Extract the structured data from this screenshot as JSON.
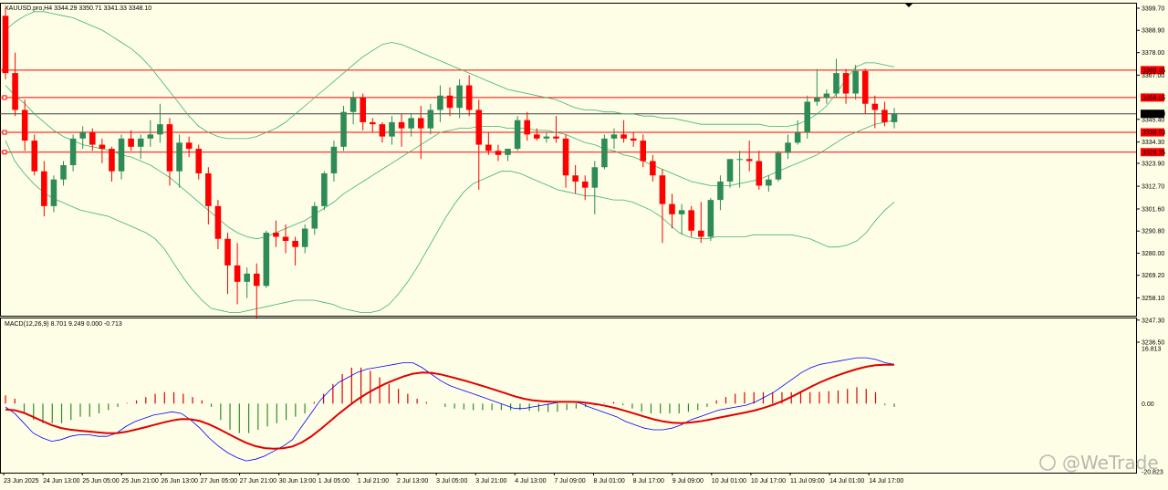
{
  "header": {
    "symbol_line": "XAUUSD.pro,H4  3344.29 3350.71 3341.33 3348.10",
    "macd_line": "MACD(12,26,9) 8.701 9.249 0.000 -0.713"
  },
  "watermark": "@WeTrade",
  "colors": {
    "background": "#fefee6",
    "bull": "#2e8b57",
    "bear": "#ff0000",
    "band": "#3cb371",
    "hline": "#ff0000",
    "macd_line": "#0000ff",
    "signal_line": "#e00000"
  },
  "chart_data": [
    {
      "type": "candlestick",
      "symbol": "XAUUSD.pro",
      "timeframe": "H4",
      "ylim": [
        3236.5,
        3399.7
      ],
      "y_ticks": [
        3399.7,
        3388.9,
        3378.0,
        3367.0,
        3345.4,
        3334.3,
        3323.9,
        3312.7,
        3301.6,
        3290.8,
        3280.0,
        3269.2,
        3258.1,
        3247.3,
        3236.5
      ],
      "price_levels": [
        {
          "label": "3369.45",
          "value": 3369.45
        },
        {
          "label": "3356.05",
          "value": 3356.05
        },
        {
          "label": "3339.03",
          "value": 3339.03
        },
        {
          "label": "3329.35",
          "value": 3329.35
        }
      ],
      "current_price": {
        "label": "3348.10",
        "value": 3348.1
      },
      "x_labels": [
        "23 Jun 2025",
        "24 Jun 13:00",
        "25 Jun 05:00",
        "25 Jun 21:00",
        "26 Jun 13:00",
        "27 Jun 05:00",
        "27 Jun 21:00",
        "30 Jun 13:00",
        "1 Jul 05:00",
        "1 Jul 21:00",
        "2 Jul 13:00",
        "3 Jul 05:00",
        "3 Jul 21:00",
        "4 Jul 13:00",
        "7 Jul 09:00",
        "8 Jul 01:00",
        "8 Jul 17:00",
        "9 Jul 09:00",
        "10 Jul 01:00",
        "10 Jul 17:00",
        "11 Jul 09:00",
        "14 Jul 01:00",
        "14 Jul 17:00"
      ],
      "candles": [
        [
          3396,
          3400,
          3365,
          3368
        ],
        [
          3368,
          3378,
          3347,
          3350
        ],
        [
          3350,
          3355,
          3330,
          3335
        ],
        [
          3335,
          3338,
          3318,
          3320
        ],
        [
          3320,
          3325,
          3298,
          3303
        ],
        [
          3303,
          3318,
          3300,
          3316
        ],
        [
          3316,
          3325,
          3313,
          3323
        ],
        [
          3323,
          3338,
          3320,
          3336
        ],
        [
          3336,
          3342,
          3331,
          3339
        ],
        [
          3339,
          3341,
          3330,
          3333
        ],
        [
          3333,
          3336,
          3324,
          3331
        ],
        [
          3331,
          3332,
          3315,
          3320
        ],
        [
          3320,
          3338,
          3316,
          3336
        ],
        [
          3336,
          3340,
          3330,
          3332
        ],
        [
          3332,
          3338,
          3326,
          3336
        ],
        [
          3336,
          3345,
          3332,
          3338
        ],
        [
          3338,
          3353,
          3334,
          3343
        ],
        [
          3343,
          3346,
          3313,
          3320
        ],
        [
          3320,
          3338,
          3312,
          3334
        ],
        [
          3334,
          3337,
          3327,
          3331
        ],
        [
          3331,
          3333,
          3316,
          3319
        ],
        [
          3319,
          3322,
          3294,
          3303
        ],
        [
          3303,
          3306,
          3282,
          3287
        ],
        [
          3287,
          3290,
          3260,
          3274
        ],
        [
          3274,
          3285,
          3255,
          3266
        ],
        [
          3266,
          3273,
          3258,
          3270
        ],
        [
          3270,
          3275,
          3248,
          3264
        ],
        [
          3264,
          3291,
          3263,
          3290
        ],
        [
          3290,
          3296,
          3283,
          3288
        ],
        [
          3288,
          3294,
          3280,
          3286
        ],
        [
          3286,
          3288,
          3274,
          3283
        ],
        [
          3283,
          3294,
          3280,
          3292
        ],
        [
          3292,
          3305,
          3289,
          3303
        ],
        [
          3303,
          3320,
          3301,
          3319
        ],
        [
          3319,
          3335,
          3315,
          3332
        ],
        [
          3332,
          3352,
          3330,
          3349
        ],
        [
          3349,
          3359,
          3343,
          3356
        ],
        [
          3356,
          3358,
          3340,
          3344
        ],
        [
          3344,
          3346,
          3339,
          3343
        ],
        [
          3343,
          3344,
          3334,
          3337
        ],
        [
          3337,
          3347,
          3333,
          3344
        ],
        [
          3344,
          3348,
          3332,
          3341
        ],
        [
          3341,
          3348,
          3337,
          3346
        ],
        [
          3346,
          3352,
          3326,
          3341
        ],
        [
          3341,
          3353,
          3338,
          3350
        ],
        [
          3350,
          3362,
          3344,
          3357
        ],
        [
          3357,
          3361,
          3347,
          3351
        ],
        [
          3351,
          3365,
          3346,
          3362
        ],
        [
          3362,
          3367,
          3347,
          3350
        ],
        [
          3350,
          3355,
          3311,
          3333
        ],
        [
          3333,
          3339,
          3328,
          3330
        ],
        [
          3330,
          3333,
          3325,
          3328
        ],
        [
          3328,
          3331,
          3325,
          3331
        ],
        [
          3331,
          3347,
          3330,
          3345
        ],
        [
          3345,
          3349,
          3335,
          3338
        ],
        [
          3338,
          3341,
          3335,
          3336
        ],
        [
          3336,
          3339,
          3334,
          3337
        ],
        [
          3337,
          3347,
          3334,
          3336
        ],
        [
          3336,
          3338,
          3312,
          3318
        ],
        [
          3318,
          3323,
          3309,
          3315
        ],
        [
          3315,
          3318,
          3306,
          3312
        ],
        [
          3312,
          3325,
          3299,
          3322
        ],
        [
          3322,
          3338,
          3321,
          3336
        ],
        [
          3336,
          3341,
          3331,
          3338
        ],
        [
          3338,
          3345,
          3334,
          3336
        ],
        [
          3336,
          3339,
          3332,
          3335
        ],
        [
          3335,
          3338,
          3322,
          3325
        ],
        [
          3325,
          3328,
          3315,
          3318
        ],
        [
          3318,
          3321,
          3285,
          3304
        ],
        [
          3304,
          3309,
          3292,
          3299
        ],
        [
          3299,
          3304,
          3289,
          3301
        ],
        [
          3301,
          3303,
          3288,
          3291
        ],
        [
          3291,
          3305,
          3285,
          3288
        ],
        [
          3288,
          3307,
          3286,
          3306
        ],
        [
          3306,
          3318,
          3301,
          3315
        ],
        [
          3315,
          3323,
          3312,
          3326
        ],
        [
          3326,
          3330,
          3312,
          3326
        ],
        [
          3326,
          3335,
          3320,
          3325
        ],
        [
          3325,
          3330,
          3311,
          3313
        ],
        [
          3313,
          3318,
          3310,
          3316
        ],
        [
          3316,
          3330,
          3315,
          3329
        ],
        [
          3329,
          3338,
          3326,
          3334
        ],
        [
          3334,
          3345,
          3333,
          3339
        ],
        [
          3339,
          3357,
          3336,
          3354
        ],
        [
          3354,
          3370,
          3352,
          3356
        ],
        [
          3356,
          3360,
          3353,
          3358
        ],
        [
          3358,
          3375,
          3356,
          3368
        ],
        [
          3368,
          3370,
          3353,
          3358
        ],
        [
          3358,
          3372,
          3355,
          3369
        ],
        [
          3369,
          3370,
          3348,
          3353
        ],
        [
          3353,
          3357,
          3341,
          3350
        ],
        [
          3350,
          3354,
          3342,
          3344
        ],
        [
          3344,
          3351,
          3341,
          3348
        ]
      ],
      "bollinger_upper": [
        3389,
        3393,
        3396,
        3398,
        3398,
        3397,
        3396,
        3395,
        3393,
        3391,
        3389,
        3386,
        3383,
        3380,
        3376,
        3371,
        3365,
        3359,
        3353,
        3347,
        3342,
        3339,
        3337,
        3336,
        3336,
        3336,
        3337,
        3339,
        3341,
        3344,
        3348,
        3352,
        3356,
        3360,
        3364,
        3368,
        3372,
        3376,
        3379,
        3382,
        3383,
        3382,
        3380,
        3378,
        3376,
        3374,
        3372,
        3370,
        3368,
        3366,
        3364,
        3362,
        3360,
        3359,
        3358,
        3357,
        3356,
        3355,
        3353,
        3351,
        3350,
        3350,
        3349,
        3349,
        3348,
        3348,
        3347,
        3347,
        3346,
        3346,
        3345,
        3344,
        3343,
        3343,
        3343,
        3343,
        3343,
        3343,
        3343,
        3342,
        3342,
        3342,
        3343,
        3345,
        3348,
        3352,
        3358,
        3365,
        3371,
        3373,
        3373,
        3372,
        3371
      ],
      "bollinger_middle": [
        3362,
        3357,
        3353,
        3348,
        3344,
        3340,
        3337,
        3335,
        3333,
        3332,
        3331,
        3330,
        3328,
        3327,
        3325,
        3323,
        3320,
        3317,
        3313,
        3309,
        3305,
        3301,
        3297,
        3293,
        3290,
        3288,
        3287,
        3288,
        3290,
        3292,
        3294,
        3296,
        3299,
        3302,
        3305,
        3309,
        3312,
        3315,
        3318,
        3321,
        3324,
        3327,
        3330,
        3333,
        3336,
        3339,
        3340,
        3341,
        3341,
        3342,
        3342,
        3342,
        3341,
        3341,
        3341,
        3340,
        3340,
        3339,
        3338,
        3336,
        3334,
        3333,
        3331,
        3330,
        3328,
        3327,
        3325,
        3323,
        3321,
        3319,
        3317,
        3315,
        3314,
        3313,
        3313,
        3313,
        3314,
        3315,
        3316,
        3318,
        3320,
        3322,
        3324,
        3326,
        3328,
        3331,
        3334,
        3337,
        3339,
        3341,
        3343,
        3344,
        3345
      ],
      "bollinger_lower": [
        3335,
        3325,
        3319,
        3314,
        3310,
        3307,
        3305,
        3303,
        3301,
        3300,
        3299,
        3298,
        3296,
        3294,
        3292,
        3290,
        3287,
        3282,
        3275,
        3268,
        3262,
        3257,
        3253,
        3252,
        3251,
        3251,
        3252,
        3253,
        3254,
        3255,
        3256,
        3257,
        3257,
        3257,
        3256,
        3255,
        3253,
        3252,
        3251,
        3251,
        3252,
        3255,
        3260,
        3266,
        3273,
        3281,
        3289,
        3297,
        3304,
        3310,
        3314,
        3316,
        3318,
        3320,
        3320,
        3319,
        3317,
        3315,
        3313,
        3311,
        3310,
        3309,
        3308,
        3308,
        3307,
        3306,
        3306,
        3305,
        3303,
        3301,
        3298,
        3294,
        3290,
        3288,
        3287,
        3287,
        3288,
        3288,
        3288,
        3288,
        3289,
        3289,
        3289,
        3289,
        3289,
        3288,
        3287,
        3285,
        3283,
        3283,
        3284,
        3286,
        3290,
        3296,
        3301,
        3305
      ]
    },
    {
      "type": "bar+line",
      "title": "MACD(12,26,9) 8.701 9.249 0.000 -0.713",
      "ylim": [
        -20.823,
        16.813
      ],
      "y_ticks": [
        16.813,
        0.0,
        -20.823
      ],
      "histogram": [
        2.5,
        1.5,
        -3,
        -5,
        -6,
        -6,
        -6,
        -5,
        -4,
        -4,
        -3,
        -2,
        -1,
        0.2,
        1,
        2,
        3,
        3.5,
        3.5,
        3,
        2,
        1,
        -1,
        -5,
        -8,
        -9,
        -9,
        -8,
        -7,
        -6,
        -5,
        -4,
        -3,
        0.5,
        3,
        6,
        9,
        11,
        11,
        10,
        8,
        6,
        4.5,
        3,
        1.5,
        0.5,
        0,
        -1,
        -1.5,
        -1.8,
        -2,
        -2,
        -2,
        -2,
        -2,
        -2,
        -2.2,
        -2.4,
        -2.6,
        -2.5,
        -2,
        -1.5,
        -1,
        -0.5,
        0.2,
        0.5,
        -0.5,
        -1.5,
        -2.5,
        -3,
        -3,
        -3,
        -3,
        -2.5,
        -2,
        -1,
        1,
        2,
        3,
        3.5,
        3.5,
        3.5,
        3.5,
        3.5,
        3.5,
        3.5,
        3.5,
        3.6,
        3.8,
        4,
        4.5,
        5,
        4.5,
        3.5,
        -0.5,
        -1
      ],
      "macd_line": [
        -1,
        -3,
        -6,
        -9,
        -10.5,
        -11.5,
        -11,
        -10,
        -9.5,
        -9.5,
        -10,
        -10,
        -9,
        -7,
        -5.5,
        -4.5,
        -3.5,
        -3,
        -2.5,
        -3,
        -5,
        -7.5,
        -10.5,
        -13,
        -15,
        -16.5,
        -17.5,
        -17,
        -16,
        -14.5,
        -13,
        -11,
        -7,
        -3,
        1,
        4,
        6.5,
        8,
        9.5,
        10.5,
        11,
        11.5,
        12,
        12.5,
        12.5,
        11,
        9,
        7,
        5.5,
        4.5,
        3.5,
        2.5,
        1.5,
        0.5,
        -0.5,
        -1.5,
        -1.5,
        -1,
        -0.5,
        0,
        0.5,
        0.5,
        0.2,
        -1,
        -2,
        -3,
        -4,
        -5.5,
        -6.5,
        -7.5,
        -8,
        -8,
        -7.5,
        -6.5,
        -5,
        -4,
        -3,
        -2,
        -1.5,
        -1,
        -0.5,
        0.5,
        2,
        3.5,
        5.5,
        7.5,
        9.5,
        11,
        12,
        12.5,
        13,
        13.5,
        14,
        14,
        13.5,
        12.5,
        12
      ]
    }
  ]
}
